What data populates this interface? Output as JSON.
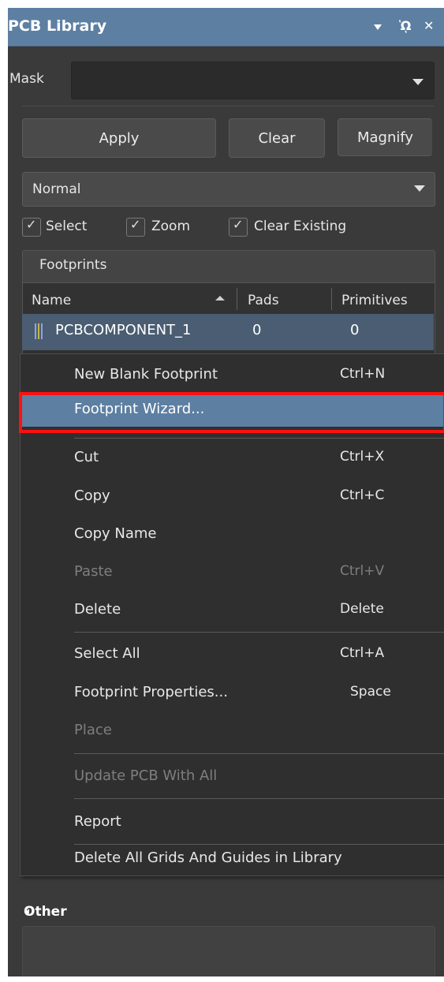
{
  "panel": {
    "title": "PCB Library",
    "title_icons": [
      "dropdown-arrow-icon",
      "pin-icon",
      "close-icon"
    ]
  },
  "mask": {
    "label": "Mask",
    "value": ""
  },
  "buttons": {
    "apply": "Apply",
    "clear": "Clear",
    "magnify": "Magnify"
  },
  "mode": {
    "selected": "Normal"
  },
  "checkboxes": [
    {
      "label": "Select",
      "checked": true
    },
    {
      "label": "Zoom",
      "checked": true
    },
    {
      "label": "Clear Existing",
      "checked": true
    }
  ],
  "footprints": {
    "title": "Footprints",
    "columns": [
      "Name",
      "Pads",
      "Primitives"
    ],
    "rows": [
      {
        "name": "PCBCOMPONENT_1",
        "pads": "0",
        "primitives": "0"
      }
    ]
  },
  "context_menu": {
    "items": [
      {
        "label": "New Blank Footprint",
        "shortcut": "Ctrl+N",
        "enabled": true
      },
      {
        "label": "Footprint Wizard...",
        "shortcut": "",
        "enabled": true,
        "highlighted": true
      },
      {
        "label": "Cut",
        "shortcut": "Ctrl+X",
        "enabled": true
      },
      {
        "label": "Copy",
        "shortcut": "Ctrl+C",
        "enabled": true
      },
      {
        "label": "Copy Name",
        "shortcut": "",
        "enabled": true
      },
      {
        "label": "Paste",
        "shortcut": "Ctrl+V",
        "enabled": false
      },
      {
        "label": "Delete",
        "shortcut": "Delete",
        "enabled": true
      },
      {
        "label": "Select All",
        "shortcut": "Ctrl+A",
        "enabled": true
      },
      {
        "label": "Footprint Properties...",
        "shortcut": "Space",
        "enabled": true
      },
      {
        "label": "Place",
        "shortcut": "",
        "enabled": false
      },
      {
        "label": "Update PCB With All",
        "shortcut": "",
        "enabled": false
      },
      {
        "label": "Report",
        "shortcut": "",
        "enabled": true
      },
      {
        "label": "Delete All Grids And Guides in Library",
        "shortcut": "",
        "enabled": true
      }
    ]
  },
  "other_section": {
    "title": "Other"
  },
  "colors": {
    "panel_bg": "#3a3a3a",
    "title_bar": "#5d7fa2",
    "selection": "#4a5d72",
    "menu_highlight": "#5d7fa2",
    "highlight_outline": "#ff1010"
  }
}
